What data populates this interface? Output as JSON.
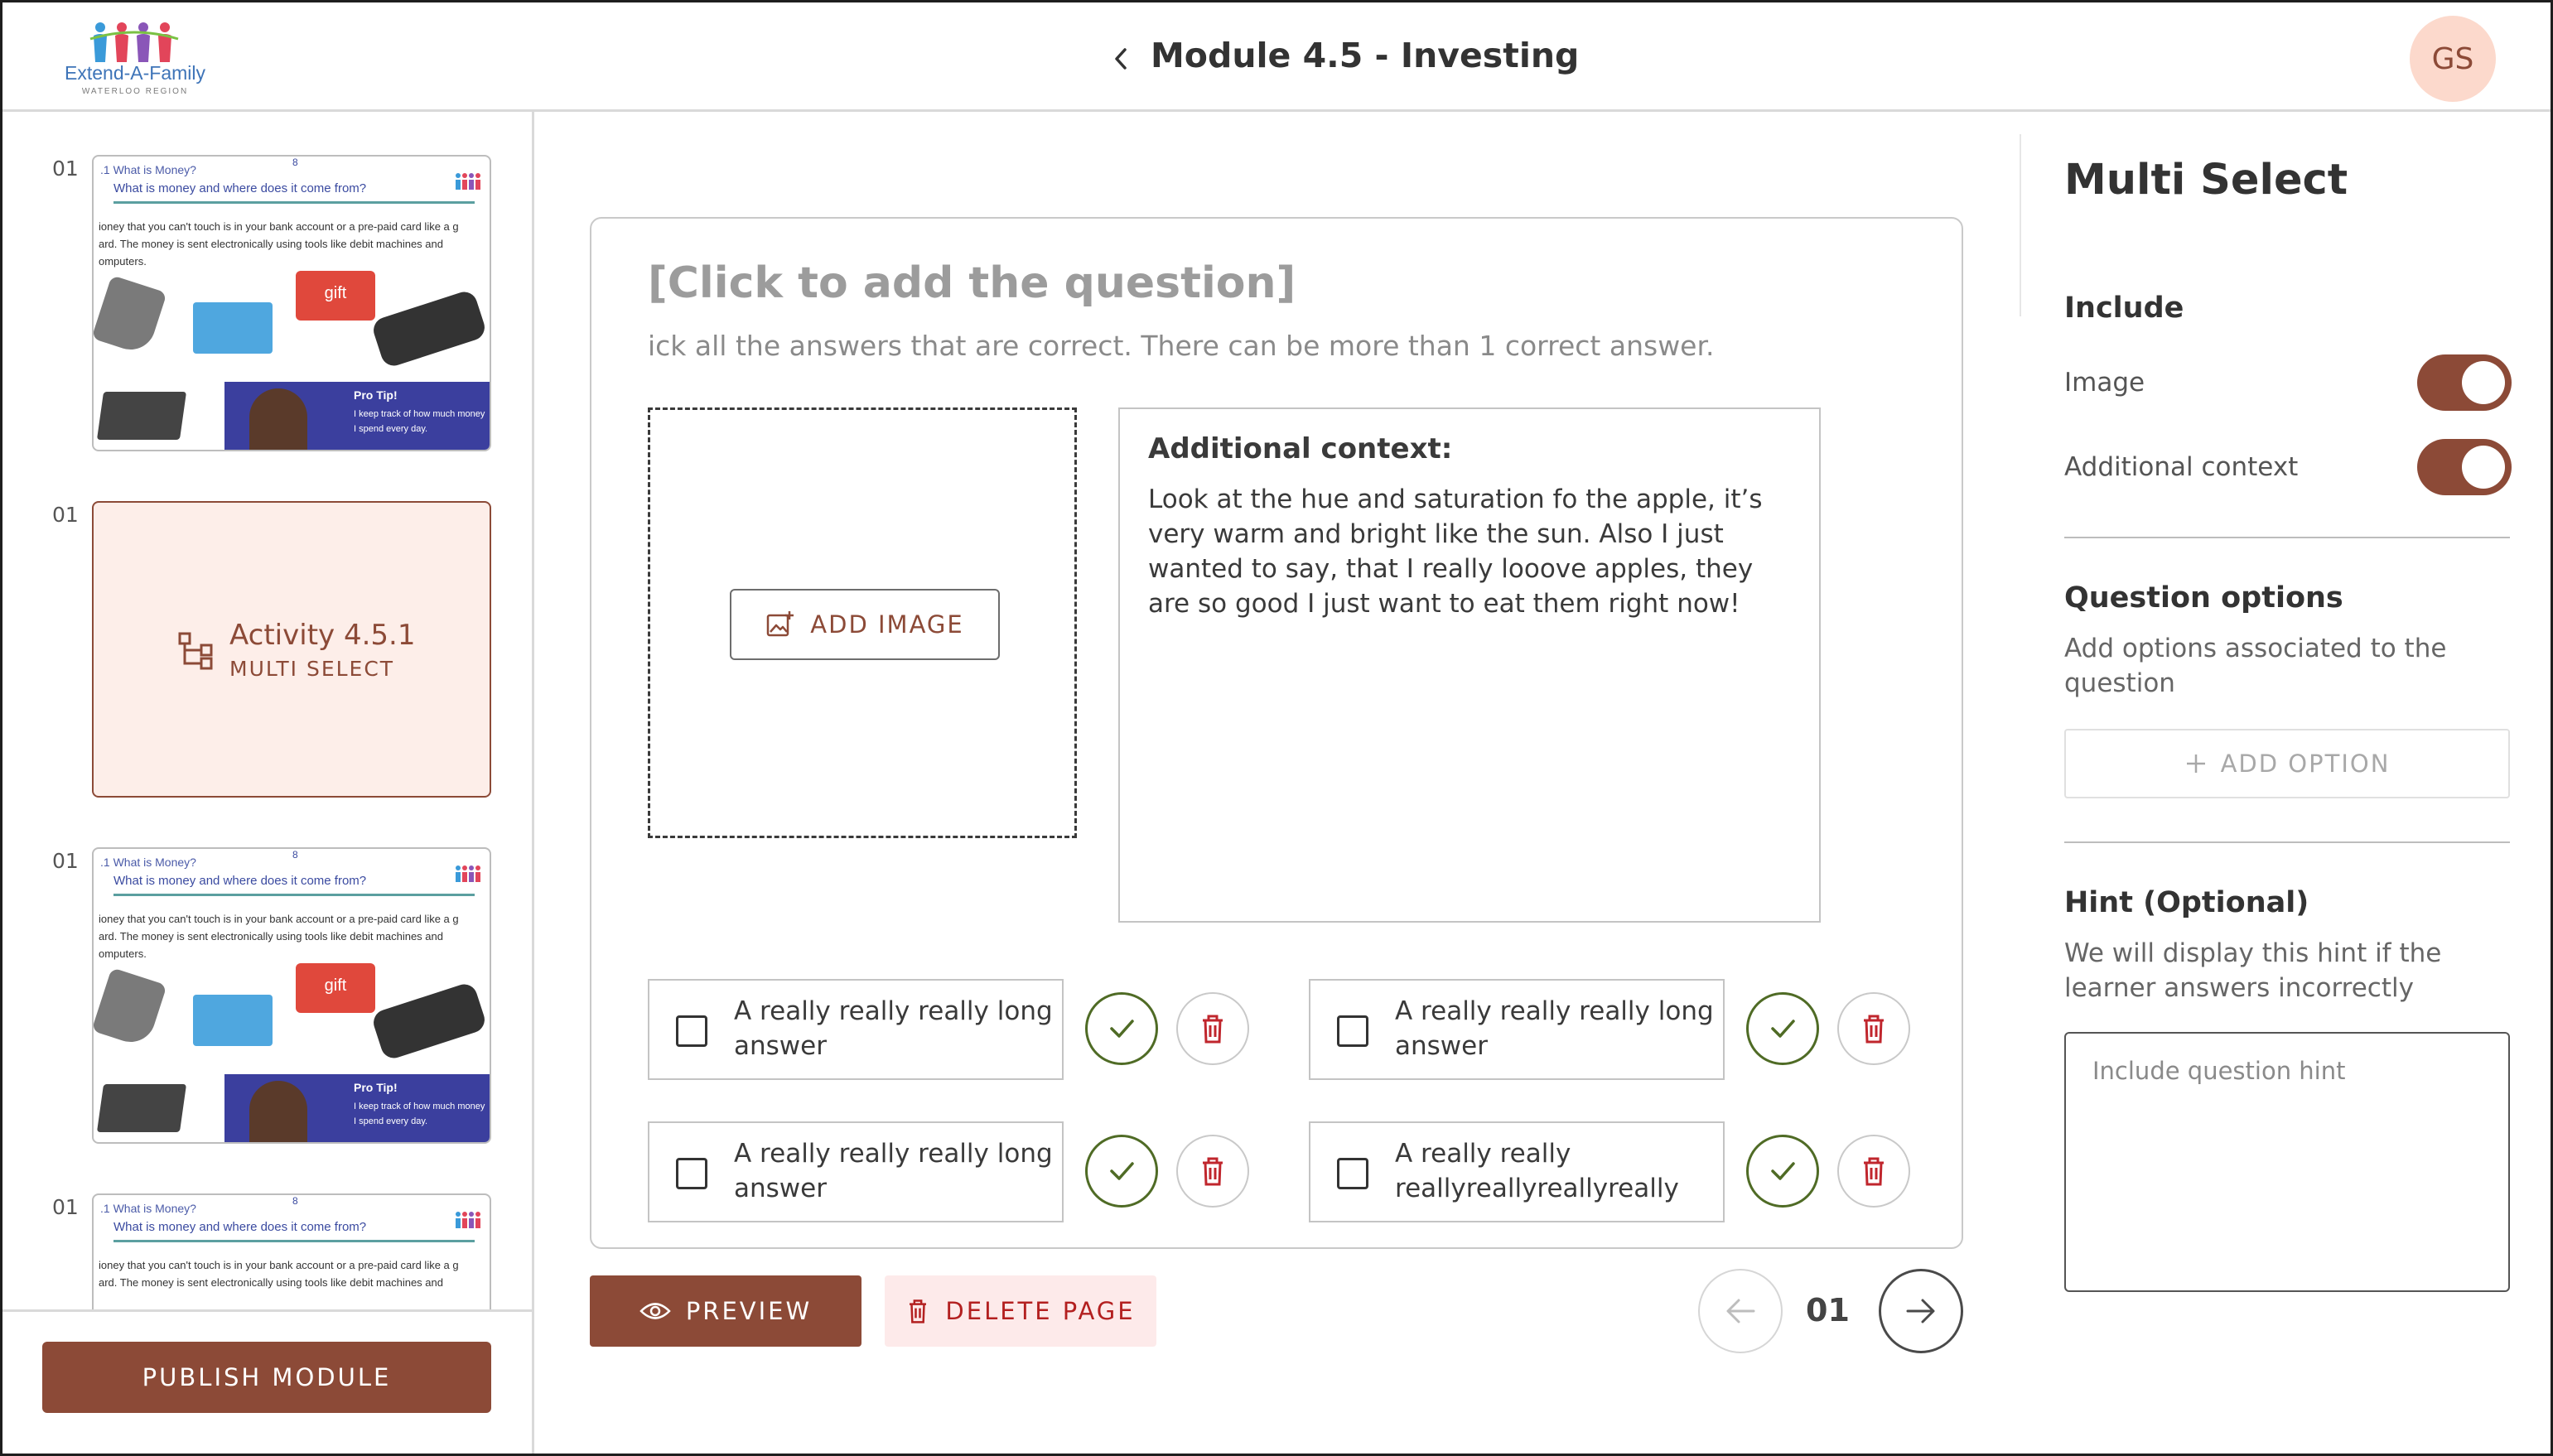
{
  "header": {
    "logo_text": "Extend-A-Family",
    "logo_sub": "WATERLOO REGION",
    "title": "Module 4.5 - Investing",
    "avatar_initials": "GS"
  },
  "sidebar": {
    "slides": [
      {
        "number": "01",
        "type": "content",
        "title": ".1 What is Money?",
        "subtitle": "What is money and where does it come from?",
        "page_marker": "8",
        "body": "ioney that you can't touch is in your bank account or a pre-paid card like a g\nard.  The money is sent electronically using tools like debit machines and\nomputers.",
        "gift_label": "gift",
        "tip_title": "Pro Tip!",
        "tip_text": "I keep track of how much money I spend every day."
      },
      {
        "number": "01",
        "type": "activity",
        "title": "Activity 4.5.1",
        "subtitle": "MULTI SELECT"
      },
      {
        "number": "01",
        "type": "content",
        "title": ".1 What is Money?",
        "subtitle": "What is money and where does it come from?",
        "page_marker": "8",
        "body": "ioney that you can't touch is in your bank account or a pre-paid card like a g\nard.  The money is sent electronically using tools like debit machines and\nomputers.",
        "gift_label": "gift",
        "tip_title": "Pro Tip!",
        "tip_text": "I keep track of how much money I spend every day."
      },
      {
        "number": "01",
        "type": "content",
        "title": ".1 What is Money?",
        "subtitle": "What is money and where does it come from?",
        "page_marker": "8",
        "body": "ioney that you can't touch is in your bank account or a pre-paid card like a g\nard.  The money is sent electronically using tools like debit machines and"
      }
    ],
    "publish_label": "PUBLISH MODULE"
  },
  "editor": {
    "question_placeholder": "[Click to add the question]",
    "instruction": "ick all the answers that are correct. There can be more than 1 correct answer.",
    "add_image_label": "ADD IMAGE",
    "context_label": "Additional context:",
    "context_text": "Look at the hue and saturation fo the apple, it’s very warm and bright like the sun. Also I just wanted to say, that I really looove apples, they are so good I just want to eat them right now!",
    "answers": [
      {
        "text": "A really really really long answer"
      },
      {
        "text": "A really really really long answer"
      },
      {
        "text": "A really really really long answer"
      },
      {
        "text": "A really really reallyreallyreallyreally"
      }
    ]
  },
  "actions": {
    "preview_label": "PREVIEW",
    "delete_page_label": "DELETE PAGE",
    "page_number": "01"
  },
  "panel": {
    "title": "Multi Select",
    "include_heading": "Include",
    "toggle_image_label": "Image",
    "toggle_context_label": "Additional context",
    "toggles": {
      "image": true,
      "additional_context": true
    },
    "question_options_heading": "Question options",
    "question_options_desc": "Add options associated to the question",
    "add_option_label": "ADD OPTION",
    "hint_heading": "Hint (Optional)",
    "hint_desc": "We will display this hint if the learner answers incorrectly",
    "hint_placeholder": "Include question hint"
  },
  "colors": {
    "brand": "#8c4a37",
    "brand_light": "#fdeee9",
    "correct": "#4f6b25",
    "danger": "#b32020",
    "avatar_bg": "#fcd9cc"
  },
  "icons": [
    "back-chevron-icon",
    "activity-icon",
    "add-image-icon",
    "check-icon",
    "trash-icon",
    "eye-icon",
    "arrow-left-icon",
    "arrow-right-icon",
    "plus-icon"
  ]
}
